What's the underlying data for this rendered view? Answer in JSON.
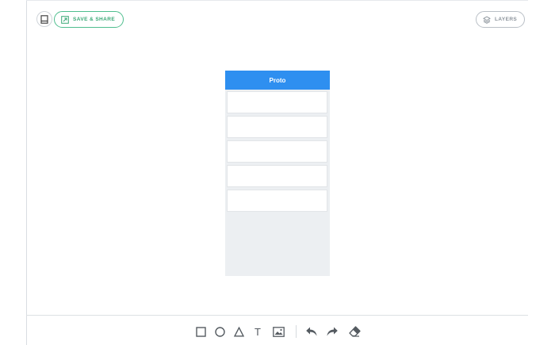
{
  "toolbar": {
    "save_share_label": "SAVE & SHARE",
    "layers_label": "LAYERS"
  },
  "canvas": {
    "phone_title": "Proto",
    "row_count": 5,
    "header_color": "#2e8ff0"
  },
  "tools": {
    "text_glyph": "T"
  },
  "icons": [
    "book-icon",
    "share-icon",
    "layers-icon",
    "rectangle-tool-icon",
    "ellipse-tool-icon",
    "triangle-tool-icon",
    "text-tool-icon",
    "image-tool-icon",
    "undo-icon",
    "redo-icon",
    "eraser-icon"
  ]
}
